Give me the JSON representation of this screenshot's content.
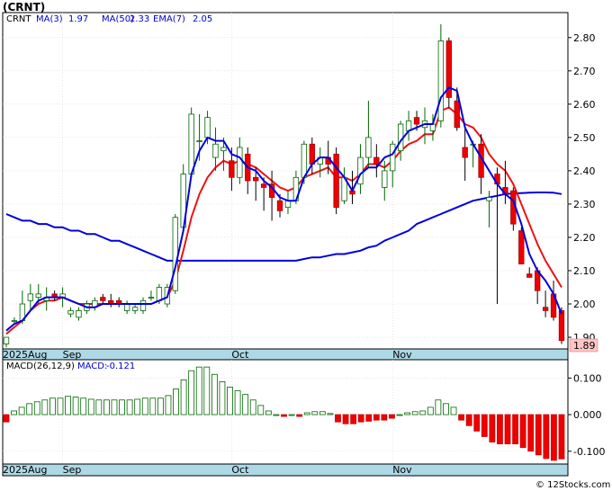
{
  "title": "(CRNT)",
  "copyright": "© 12Stocks.com",
  "chart_data": [
    {
      "type": "candlestick",
      "ticker": "CRNT",
      "legend": {
        "ticker_label": "CRNT",
        "ma3_label": "MA(3)",
        "ma3_value": "1.97",
        "ma50_label": "MA(50)",
        "ma50_value": "2.33",
        "ema7_label": "EMA(7)",
        "ema7_value": "2.05"
      },
      "last_price_label": "1.89",
      "y_ticks": [
        "1.90",
        "2.00",
        "2.10",
        "2.20",
        "2.30",
        "2.40",
        "2.50",
        "2.60",
        "2.70",
        "2.80"
      ],
      "ylim": [
        1.865,
        2.875
      ],
      "x_labels": [
        {
          "label": "2025Aug",
          "index": 0
        },
        {
          "label": "Sep",
          "index": 7
        },
        {
          "label": "Oct",
          "index": 28
        },
        {
          "label": "Nov",
          "index": 48
        }
      ],
      "candles": [
        [
          1.88,
          1.9,
          1.87,
          1.9
        ],
        [
          1.95,
          1.96,
          1.94,
          1.95
        ],
        [
          1.95,
          2.04,
          1.94,
          2.0
        ],
        [
          2.01,
          2.06,
          1.98,
          2.03
        ],
        [
          2.02,
          2.06,
          2.0,
          2.03
        ],
        [
          2.01,
          2.05,
          1.98,
          2.02
        ],
        [
          2.03,
          2.04,
          2.01,
          2.02
        ],
        [
          2.02,
          2.05,
          1.99,
          2.03
        ],
        [
          1.97,
          1.99,
          1.96,
          1.98
        ],
        [
          1.96,
          1.99,
          1.95,
          1.98
        ],
        [
          1.98,
          2.01,
          1.97,
          2.0
        ],
        [
          1.99,
          2.02,
          1.98,
          2.01
        ],
        [
          2.02,
          2.03,
          2.0,
          2.01
        ],
        [
          2.01,
          2.03,
          1.99,
          2.0
        ],
        [
          2.01,
          2.02,
          1.99,
          2.0
        ],
        [
          1.98,
          2.01,
          1.97,
          2.0
        ],
        [
          1.98,
          2.0,
          1.97,
          1.99
        ],
        [
          1.98,
          2.02,
          1.97,
          2.01
        ],
        [
          2.02,
          2.04,
          2.01,
          2.02
        ],
        [
          2.01,
          2.06,
          2.0,
          2.05
        ],
        [
          2.0,
          2.06,
          1.99,
          2.05
        ],
        [
          2.04,
          2.27,
          2.03,
          2.26
        ],
        [
          2.23,
          2.42,
          2.22,
          2.39
        ],
        [
          2.39,
          2.59,
          2.38,
          2.57
        ],
        [
          2.49,
          2.57,
          2.43,
          2.49
        ],
        [
          2.5,
          2.58,
          2.48,
          2.56
        ],
        [
          2.44,
          2.53,
          2.4,
          2.48
        ],
        [
          2.46,
          2.5,
          2.4,
          2.47
        ],
        [
          2.43,
          2.47,
          2.34,
          2.38
        ],
        [
          2.38,
          2.5,
          2.36,
          2.47
        ],
        [
          2.45,
          2.47,
          2.33,
          2.37
        ],
        [
          2.38,
          2.41,
          2.31,
          2.37
        ],
        [
          2.36,
          2.38,
          2.28,
          2.35
        ],
        [
          2.36,
          2.4,
          2.25,
          2.32
        ],
        [
          2.31,
          2.33,
          2.26,
          2.28
        ],
        [
          2.29,
          2.34,
          2.27,
          2.31
        ],
        [
          2.31,
          2.4,
          2.3,
          2.38
        ],
        [
          2.38,
          2.49,
          2.36,
          2.48
        ],
        [
          2.48,
          2.5,
          2.39,
          2.42
        ],
        [
          2.42,
          2.47,
          2.38,
          2.44
        ],
        [
          2.44,
          2.49,
          2.39,
          2.42
        ],
        [
          2.45,
          2.47,
          2.27,
          2.29
        ],
        [
          2.31,
          2.41,
          2.3,
          2.38
        ],
        [
          2.34,
          2.4,
          2.3,
          2.33
        ],
        [
          2.36,
          2.48,
          2.33,
          2.44
        ],
        [
          2.44,
          2.61,
          2.41,
          2.5
        ],
        [
          2.44,
          2.48,
          2.38,
          2.42
        ],
        [
          2.35,
          2.43,
          2.31,
          2.4
        ],
        [
          2.4,
          2.49,
          2.35,
          2.48
        ],
        [
          2.46,
          2.55,
          2.43,
          2.54
        ],
        [
          2.52,
          2.58,
          2.49,
          2.55
        ],
        [
          2.56,
          2.58,
          2.52,
          2.54
        ],
        [
          2.53,
          2.59,
          2.48,
          2.55
        ],
        [
          2.52,
          2.57,
          2.49,
          2.54
        ],
        [
          2.55,
          2.84,
          2.53,
          2.79
        ],
        [
          2.79,
          2.8,
          2.59,
          2.62
        ],
        [
          2.61,
          2.65,
          2.52,
          2.53
        ],
        [
          2.47,
          2.53,
          2.37,
          2.44
        ],
        [
          2.48,
          2.49,
          2.41,
          2.48
        ],
        [
          2.48,
          2.51,
          2.33,
          2.38
        ],
        [
          2.31,
          2.34,
          2.23,
          2.32
        ],
        [
          2.39,
          2.41,
          2.0,
          2.36
        ],
        [
          2.35,
          2.43,
          2.3,
          2.33
        ],
        [
          2.34,
          2.35,
          2.22,
          2.24
        ],
        [
          2.22,
          2.23,
          2.12,
          2.12
        ],
        [
          2.09,
          2.11,
          2.08,
          2.08
        ],
        [
          2.1,
          2.11,
          2.0,
          2.04
        ],
        [
          1.99,
          2.04,
          1.96,
          1.98
        ],
        [
          2.03,
          2.07,
          1.95,
          1.96
        ],
        [
          1.98,
          1.99,
          1.88,
          1.89
        ]
      ],
      "ma3": [
        1.92,
        1.94,
        1.95,
        1.98,
        2.01,
        2.02,
        2.02,
        2.02,
        2.01,
        2.0,
        1.99,
        1.99,
        2.0,
        2.0,
        2.0,
        2.0,
        2.0,
        2.0,
        2.0,
        2.01,
        2.02,
        2.11,
        2.22,
        2.39,
        2.46,
        2.5,
        2.49,
        2.49,
        2.45,
        2.44,
        2.41,
        2.4,
        2.37,
        2.35,
        2.32,
        2.31,
        2.31,
        2.38,
        2.42,
        2.44,
        2.44,
        2.41,
        2.38,
        2.34,
        2.39,
        2.41,
        2.41,
        2.44,
        2.45,
        2.49,
        2.52,
        2.53,
        2.54,
        2.54,
        2.62,
        2.65,
        2.64,
        2.53,
        2.48,
        2.44,
        2.4,
        2.36,
        2.33,
        2.31,
        2.24,
        2.15,
        2.1,
        2.07,
        2.03,
        1.97
      ],
      "ema7": [
        1.91,
        1.93,
        1.95,
        1.98,
        2.0,
        2.01,
        2.01,
        2.02,
        2.01,
        2.0,
        2.0,
        2.0,
        2.0,
        2.0,
        2.0,
        2.0,
        2.0,
        2.0,
        2.0,
        2.01,
        2.02,
        2.07,
        2.16,
        2.26,
        2.33,
        2.38,
        2.41,
        2.43,
        2.42,
        2.43,
        2.42,
        2.41,
        2.39,
        2.37,
        2.35,
        2.34,
        2.35,
        2.38,
        2.39,
        2.4,
        2.41,
        2.38,
        2.38,
        2.37,
        2.39,
        2.42,
        2.42,
        2.41,
        2.43,
        2.46,
        2.48,
        2.49,
        2.51,
        2.51,
        2.58,
        2.59,
        2.57,
        2.54,
        2.53,
        2.5,
        2.45,
        2.42,
        2.4,
        2.36,
        2.3,
        2.24,
        2.18,
        2.13,
        2.09,
        2.05
      ],
      "ma50": [
        2.27,
        2.26,
        2.25,
        2.25,
        2.24,
        2.24,
        2.23,
        2.23,
        2.22,
        2.22,
        2.21,
        2.21,
        2.2,
        2.19,
        2.19,
        2.18,
        2.17,
        2.16,
        2.15,
        2.14,
        2.13,
        2.13,
        2.13,
        2.13,
        2.13,
        2.13,
        2.13,
        2.13,
        2.13,
        2.13,
        2.13,
        2.13,
        2.13,
        2.13,
        2.13,
        2.13,
        2.13,
        2.135,
        2.14,
        2.14,
        2.145,
        2.15,
        2.15,
        2.155,
        2.16,
        2.17,
        2.175,
        2.19,
        2.2,
        2.21,
        2.22,
        2.24,
        2.25,
        2.26,
        2.27,
        2.28,
        2.29,
        2.3,
        2.31,
        2.315,
        2.32,
        2.325,
        2.33,
        2.332,
        2.333,
        2.334,
        2.335,
        2.335,
        2.334,
        2.33
      ]
    },
    {
      "type": "bar",
      "legend": {
        "params_label": "MACD(26,12,9)",
        "value_label": "MACD:",
        "value": "-0.121"
      },
      "y_ticks": [
        "-0.100",
        "0.000",
        "0.100"
      ],
      "ylim": [
        -0.135,
        0.15
      ],
      "values": [
        -0.02,
        0.01,
        0.02,
        0.03,
        0.035,
        0.04,
        0.045,
        0.045,
        0.05,
        0.048,
        0.045,
        0.042,
        0.04,
        0.04,
        0.04,
        0.04,
        0.04,
        0.042,
        0.045,
        0.045,
        0.045,
        0.052,
        0.07,
        0.095,
        0.12,
        0.13,
        0.13,
        0.11,
        0.09,
        0.075,
        0.065,
        0.055,
        0.04,
        0.025,
        0.01,
        0.0,
        -0.005,
        0.0,
        -0.005,
        0.005,
        0.008,
        0.008,
        0.003,
        -0.02,
        -0.025,
        -0.025,
        -0.02,
        -0.018,
        -0.015,
        -0.015,
        -0.01,
        0.0,
        0.005,
        0.008,
        0.01,
        0.02,
        0.04,
        0.03,
        0.02,
        -0.015,
        -0.03,
        -0.045,
        -0.06,
        -0.075,
        -0.08,
        -0.08,
        -0.08,
        -0.09,
        -0.1,
        -0.11,
        -0.12,
        -0.125,
        -0.121
      ]
    }
  ]
}
